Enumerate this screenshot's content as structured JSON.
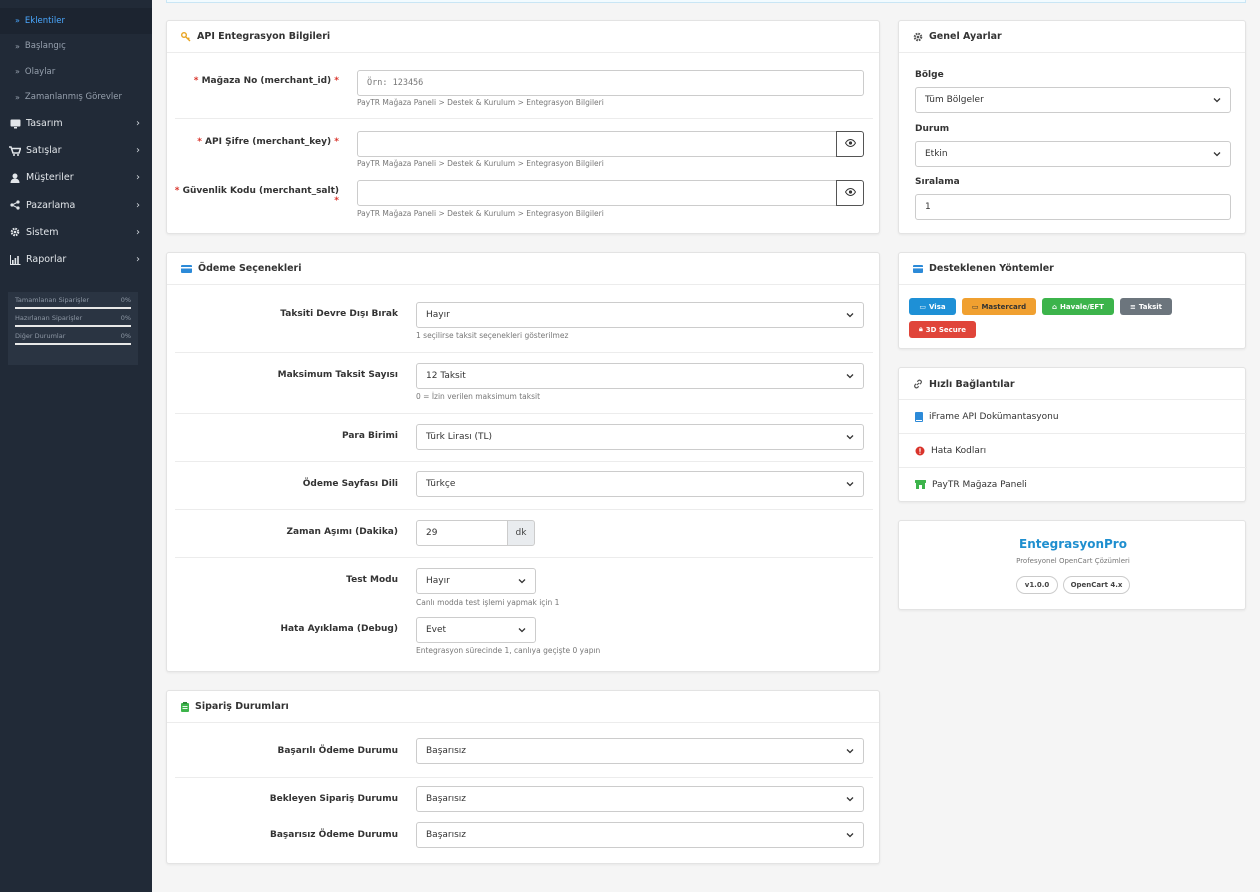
{
  "sidebar": {
    "sub_items": [
      "Eklentiler",
      "Başlangıç",
      "Olaylar",
      "Zamanlanmış Görevler"
    ],
    "nav_items": [
      {
        "label": "Tasarım",
        "icon": "monitor-icon"
      },
      {
        "label": "Satışlar",
        "icon": "cart-icon"
      },
      {
        "label": "Müşteriler",
        "icon": "user-icon"
      },
      {
        "label": "Pazarlama",
        "icon": "share-icon"
      },
      {
        "label": "Sistem",
        "icon": "gear-icon"
      },
      {
        "label": "Raporlar",
        "icon": "chart-icon"
      }
    ],
    "stats": [
      {
        "label": "Tamamlanan Siparişler",
        "value": "0%"
      },
      {
        "label": "Hazırlanan Siparişler",
        "value": "0%"
      },
      {
        "label": "Diğer Durumlar",
        "value": "0%"
      }
    ]
  },
  "api_card": {
    "title": "API Entegrasyon Bilgileri",
    "merchant_id": {
      "label": "Mağaza No (merchant_id)",
      "placeholder": "Örn: 123456",
      "help": "PayTR Mağaza Paneli > Destek & Kurulum > Entegrasyon Bilgileri"
    },
    "merchant_key": {
      "label": "API Şifre (merchant_key)",
      "help": "PayTR Mağaza Paneli > Destek & Kurulum > Entegrasyon Bilgileri"
    },
    "merchant_salt": {
      "label": "Güvenlik Kodu (merchant_salt)",
      "help": "PayTR Mağaza Paneli > Destek & Kurulum > Entegrasyon Bilgileri"
    },
    "required_mark": "*"
  },
  "payment_card": {
    "title": "Ödeme Seçenekleri",
    "installment_disable": {
      "label": "Taksiti Devre Dışı Bırak",
      "value": "Hayır",
      "help": "1 seçilirse taksit seçenekleri gösterilmez"
    },
    "max_installment": {
      "label": "Maksimum Taksit Sayısı",
      "value": "12 Taksit",
      "help": "0 = İzin verilen maksimum taksit"
    },
    "currency": {
      "label": "Para Birimi",
      "value": "Türk Lirası (TL)"
    },
    "language": {
      "label": "Ödeme Sayfası Dili",
      "value": "Türkçe"
    },
    "timeout": {
      "label": "Zaman Aşımı (Dakika)",
      "value": "29",
      "unit": "dk"
    },
    "test_mode": {
      "label": "Test Modu",
      "value": "Hayır",
      "help": "Canlı modda test işlemi yapmak için 1"
    },
    "debug": {
      "label": "Hata Ayıklama (Debug)",
      "value": "Evet",
      "help": "Entegrasyon sürecinde 1, canlıya geçişte 0 yapın"
    }
  },
  "order_card": {
    "title": "Sipariş Durumları",
    "success": {
      "label": "Başarılı Ödeme Durumu",
      "value": "Başarısız"
    },
    "pending": {
      "label": "Bekleyen Sipariş Durumu",
      "value": "Başarısız"
    },
    "failed": {
      "label": "Başarısız Ödeme Durumu",
      "value": "Başarısız"
    }
  },
  "general_card": {
    "title": "Genel Ayarlar",
    "region": {
      "label": "Bölge",
      "value": "Tüm Bölgeler"
    },
    "status": {
      "label": "Durum",
      "value": "Etkin"
    },
    "sort": {
      "label": "Sıralama",
      "value": "1"
    }
  },
  "methods_card": {
    "title": "Desteklenen Yöntemler",
    "badges": [
      {
        "label": "Visa",
        "color": "#1e90d6"
      },
      {
        "label": "Mastercard",
        "color": "#f0a030"
      },
      {
        "label": "Havale/EFT",
        "color": "#3cb44b"
      },
      {
        "label": "Taksit",
        "color": "#6c757d"
      },
      {
        "label": "3D Secure",
        "color": "#e0453a"
      }
    ]
  },
  "links_card": {
    "title": "Hızlı Bağlantılar",
    "links": [
      {
        "label": "iFrame API Dokümantasyonu",
        "icon": "book-icon"
      },
      {
        "label": "Hata Kodları",
        "icon": "alert-icon"
      },
      {
        "label": "PayTR Mağaza Paneli",
        "icon": "store-icon"
      }
    ]
  },
  "brand_card": {
    "title": "EntegrasyonPro",
    "subtitle": "Profesyonel OpenCart Çözümleri",
    "version": "v1.0.0",
    "platform": "OpenCart 4.x"
  }
}
